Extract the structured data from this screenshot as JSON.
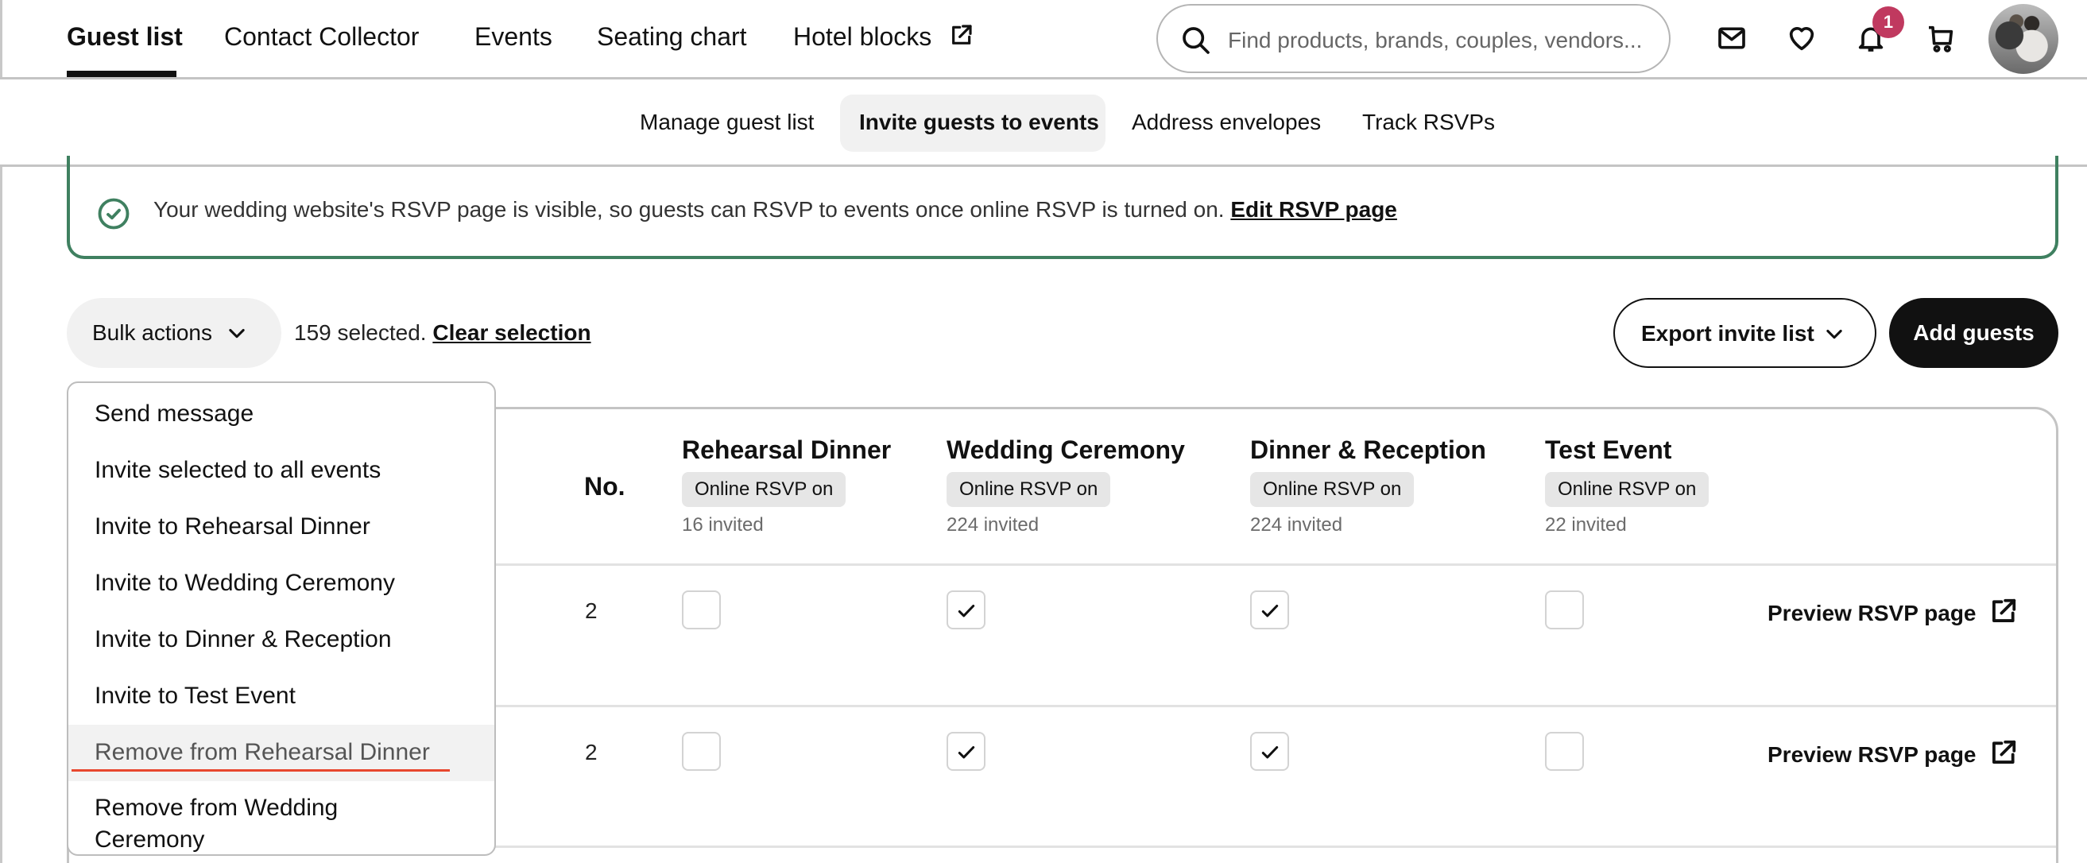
{
  "top_nav": {
    "items": [
      {
        "label": "Guest list",
        "active": true
      },
      {
        "label": "Contact Collector",
        "active": false
      },
      {
        "label": "Events",
        "active": false
      },
      {
        "label": "Seating chart",
        "active": false
      },
      {
        "label": "Hotel blocks",
        "active": false,
        "icon": "external-link-icon"
      }
    ],
    "search_placeholder": "Find products, brands, couples, vendors...",
    "icons": [
      "mail-icon",
      "heart-icon",
      "bell-icon",
      "cart-icon"
    ],
    "notification_count": "1",
    "badge_color": "#c0395f"
  },
  "sub_nav": {
    "items": [
      {
        "label": "Manage guest list",
        "active": false
      },
      {
        "label": "Invite guests to events",
        "active": true
      },
      {
        "label": "Address envelopes",
        "active": false
      },
      {
        "label": "Track RSVPs",
        "active": false
      }
    ]
  },
  "banner": {
    "text": "Your wedding website's RSVP page is visible, so guests can RSVP to events once online RSVP is turned on.",
    "link": "Edit RSVP page",
    "color": "#3f8060"
  },
  "actions": {
    "bulk_label": "Bulk actions",
    "selected_text": "159 selected.",
    "clear_label": "Clear selection",
    "export_label": "Export invite list",
    "add_label": "Add guests"
  },
  "bulk_menu": {
    "items": [
      "Send message",
      "Invite selected to all events",
      "Invite to Rehearsal Dinner",
      "Invite to Wedding Ceremony",
      "Invite to Dinner & Reception",
      "Invite to Test Event",
      "Remove from Rehearsal Dinner",
      "Remove from Wedding Ceremony"
    ],
    "hovered_index": 6
  },
  "table": {
    "no_header": "No.",
    "events": [
      {
        "title": "Rehearsal Dinner",
        "status": "Online RSVP on",
        "invited": "16 invited"
      },
      {
        "title": "Wedding Ceremony",
        "status": "Online RSVP on",
        "invited": "224 invited"
      },
      {
        "title": "Dinner & Reception",
        "status": "Online RSVP on",
        "invited": "224 invited"
      },
      {
        "title": "Test Event",
        "status": "Online RSVP on",
        "invited": "22 invited"
      }
    ],
    "preview_label": "Preview RSVP page",
    "rows": [
      {
        "no": "2",
        "invites": [
          false,
          true,
          true,
          false
        ]
      },
      {
        "no": "2",
        "invites": [
          false,
          true,
          true,
          false
        ]
      }
    ]
  }
}
